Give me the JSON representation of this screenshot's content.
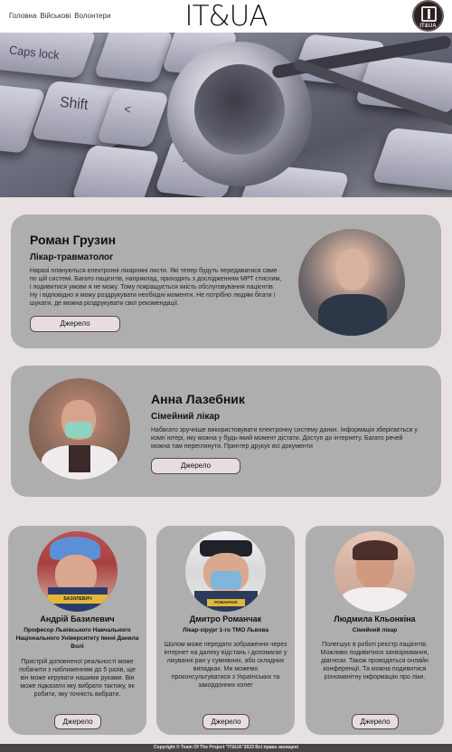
{
  "header": {
    "nav": [
      "Головна",
      "Військові",
      "Волонтери"
    ],
    "logo": "IT&UA",
    "badge": "IT&UA"
  },
  "hero": {
    "keys": [
      "Caps lock",
      "Shift",
      "<",
      ">"
    ]
  },
  "doctors_wide": [
    {
      "name": "Роман Грузин",
      "role": "Лікар-травматолог",
      "description": "Наразі плануються електронні лікарняні листи. Які тепер будуть передаватися саме по цій системі. Багато пацієнтів, наприклад, приходять з дослідженням МРТ стислим, і подивитися умови я не можу. Тому покращується якість обслуговування пацієнтів. Ну і відповідно я можу роздрукувати необхідні моменти. Не потрібно людям бігати і шукати, де можна роздрукувати свої рекомендації.",
      "button": "Джерело"
    },
    {
      "name": "Анна Лазебник",
      "role": "Сімейний лікар",
      "description": "Набагато зручніше використовувати електронну систему даних. Інформація зберігається у комп`ютері, яку можна у будь-який момент дістати. Доступ до інтернету. Багато речей можна там переглянути. Принтер друкує всі документи",
      "button": "Джерело"
    }
  ],
  "doctors_small": [
    {
      "name": "Андрій Базилевич",
      "role": "Професор Львівського Навчального Національного Університету Імені Данила Волі",
      "description": "Пристрій доповненої реальності може побачити з наближенням до 5 разів, ще він може керувати нашими руками. Він може підказати яку вибрати тактику, як робити, яку точність вибрати.",
      "button": "Джерело",
      "photo_caption": "БАЗИЛЕВИЧ"
    },
    {
      "name": "Дмитро Романчак",
      "role": "Лікар-хірург 1-го ТМО Львова",
      "description": "Шолом може передати зображення через інтернет на далеку відстань і допомагає у лікуванні ран у сумнівних, або складних випадках. Ми можемо проконсультуватися з Українських та закордонних колег",
      "button": "Джерело",
      "photo_caption": "РОМАНЧАК"
    },
    {
      "name": "Людмила Кльонкіна",
      "role": "Сімейний лікар",
      "description": "Полегшує в роботі реєстр пацієнтів. Можливо подивитися захворювання, діагнози. Також проводяться онлайн конференції. Та можна подивитися різноманітну інформацію про ліки.",
      "button": "Джерело"
    }
  ],
  "footer": {
    "text": "Copyright © Team Of The Project \"IT&UA\"2023 Всі права захищені"
  }
}
